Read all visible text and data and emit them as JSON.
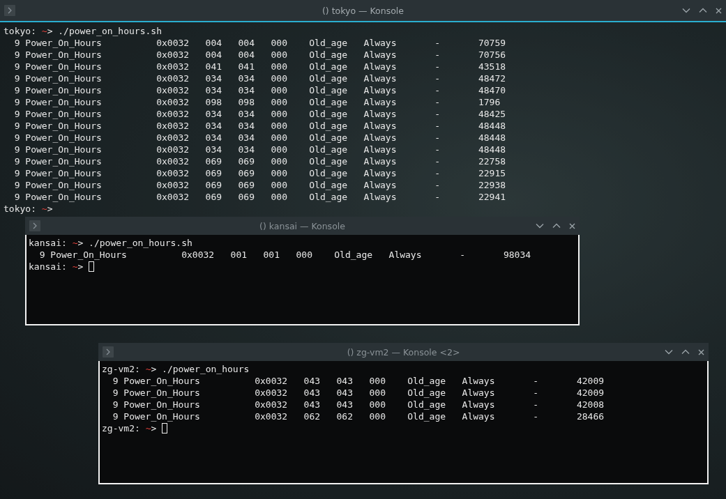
{
  "windows": [
    {
      "title": "() tokyo — Konsole",
      "active": true,
      "lines": [
        {
          "kind": "prompt",
          "host": "tokyo:",
          "cwd": "~",
          "arrow": ">",
          "command": " ./power_on_hours.sh"
        },
        {
          "kind": "row",
          "fields": [
            "9",
            "Power_On_Hours",
            "0x0032",
            "004",
            "004",
            "000",
            "Old_age",
            "Always",
            "-",
            "70759"
          ]
        },
        {
          "kind": "row",
          "fields": [
            "9",
            "Power_On_Hours",
            "0x0032",
            "004",
            "004",
            "000",
            "Old_age",
            "Always",
            "-",
            "70756"
          ]
        },
        {
          "kind": "row",
          "fields": [
            "9",
            "Power_On_Hours",
            "0x0032",
            "041",
            "041",
            "000",
            "Old_age",
            "Always",
            "-",
            "43518"
          ]
        },
        {
          "kind": "row",
          "fields": [
            "9",
            "Power_On_Hours",
            "0x0032",
            "034",
            "034",
            "000",
            "Old_age",
            "Always",
            "-",
            "48472"
          ]
        },
        {
          "kind": "row",
          "fields": [
            "9",
            "Power_On_Hours",
            "0x0032",
            "034",
            "034",
            "000",
            "Old_age",
            "Always",
            "-",
            "48470"
          ]
        },
        {
          "kind": "row",
          "fields": [
            "9",
            "Power_On_Hours",
            "0x0032",
            "098",
            "098",
            "000",
            "Old_age",
            "Always",
            "-",
            "1796"
          ]
        },
        {
          "kind": "row",
          "fields": [
            "9",
            "Power_On_Hours",
            "0x0032",
            "034",
            "034",
            "000",
            "Old_age",
            "Always",
            "-",
            "48425"
          ]
        },
        {
          "kind": "row",
          "fields": [
            "9",
            "Power_On_Hours",
            "0x0032",
            "034",
            "034",
            "000",
            "Old_age",
            "Always",
            "-",
            "48448"
          ]
        },
        {
          "kind": "row",
          "fields": [
            "9",
            "Power_On_Hours",
            "0x0032",
            "034",
            "034",
            "000",
            "Old_age",
            "Always",
            "-",
            "48448"
          ]
        },
        {
          "kind": "row",
          "fields": [
            "9",
            "Power_On_Hours",
            "0x0032",
            "034",
            "034",
            "000",
            "Old_age",
            "Always",
            "-",
            "48448"
          ]
        },
        {
          "kind": "row",
          "fields": [
            "9",
            "Power_On_Hours",
            "0x0032",
            "069",
            "069",
            "000",
            "Old_age",
            "Always",
            "-",
            "22758"
          ]
        },
        {
          "kind": "row",
          "fields": [
            "9",
            "Power_On_Hours",
            "0x0032",
            "069",
            "069",
            "000",
            "Old_age",
            "Always",
            "-",
            "22915"
          ]
        },
        {
          "kind": "row",
          "fields": [
            "9",
            "Power_On_Hours",
            "0x0032",
            "069",
            "069",
            "000",
            "Old_age",
            "Always",
            "-",
            "22938"
          ]
        },
        {
          "kind": "row",
          "fields": [
            "9",
            "Power_On_Hours",
            "0x0032",
            "069",
            "069",
            "000",
            "Old_age",
            "Always",
            "-",
            "22941"
          ]
        },
        {
          "kind": "prompt",
          "host": "tokyo:",
          "cwd": "~",
          "arrow": ">",
          "cursor": false
        }
      ]
    },
    {
      "title": "() kansai — Konsole",
      "active": false,
      "lines": [
        {
          "kind": "prompt",
          "host": "kansai:",
          "cwd": "~",
          "arrow": ">",
          "command": " ./power_on_hours.sh"
        },
        {
          "kind": "row",
          "fields": [
            "9",
            "Power_On_Hours",
            "0x0032",
            "001",
            "001",
            "000",
            "Old_age",
            "Always",
            "-",
            "98034"
          ]
        },
        {
          "kind": "prompt",
          "host": "kansai:",
          "cwd": "~",
          "arrow": ">",
          "cursor": true
        }
      ]
    },
    {
      "title": "() zg-vm2 — Konsole <2>",
      "active": false,
      "lines": [
        {
          "kind": "prompt",
          "host": "zg-vm2:",
          "cwd": "~",
          "arrow": ">",
          "command": " ./power_on_hours"
        },
        {
          "kind": "row",
          "fields": [
            "9",
            "Power_On_Hours",
            "0x0032",
            "043",
            "043",
            "000",
            "Old_age",
            "Always",
            "-",
            "42009"
          ]
        },
        {
          "kind": "row",
          "fields": [
            "9",
            "Power_On_Hours",
            "0x0032",
            "043",
            "043",
            "000",
            "Old_age",
            "Always",
            "-",
            "42009"
          ]
        },
        {
          "kind": "row",
          "fields": [
            "9",
            "Power_On_Hours",
            "0x0032",
            "043",
            "043",
            "000",
            "Old_age",
            "Always",
            "-",
            "42008"
          ]
        },
        {
          "kind": "row",
          "fields": [
            "9",
            "Power_On_Hours",
            "0x0032",
            "062",
            "062",
            "000",
            "Old_age",
            "Always",
            "-",
            "28466"
          ]
        },
        {
          "kind": "prompt",
          "host": "zg-vm2:",
          "cwd": "~",
          "arrow": ">",
          "cursor": true
        }
      ]
    }
  ]
}
